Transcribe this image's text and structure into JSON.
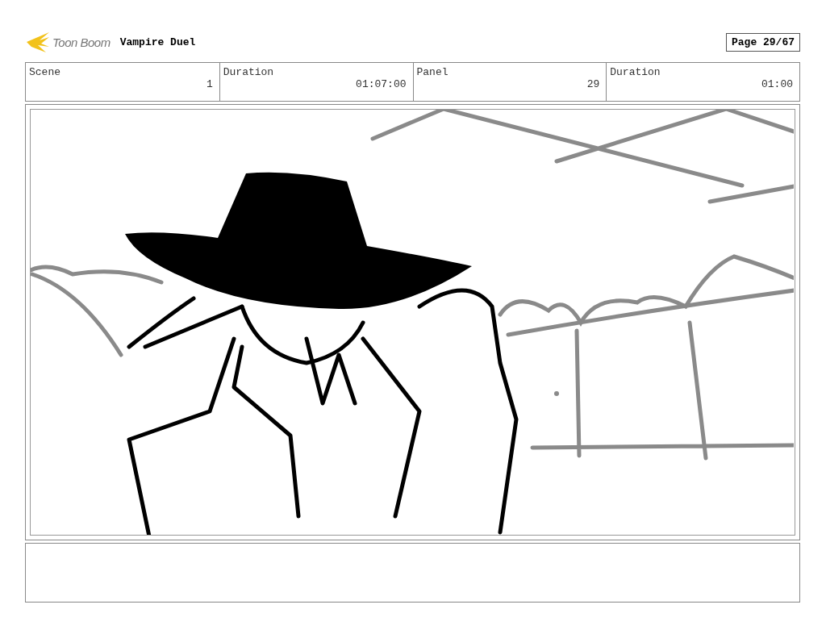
{
  "header": {
    "logo_text": "Toon Boom",
    "project_title": "Vampire Duel",
    "page": "Page 29/67"
  },
  "info_fields": [
    {
      "label": "Scene",
      "value": "1"
    },
    {
      "label": "Duration",
      "value": "01:07:00"
    },
    {
      "label": "Panel",
      "value": "29"
    },
    {
      "label": "Duration",
      "value": "01:00"
    }
  ]
}
